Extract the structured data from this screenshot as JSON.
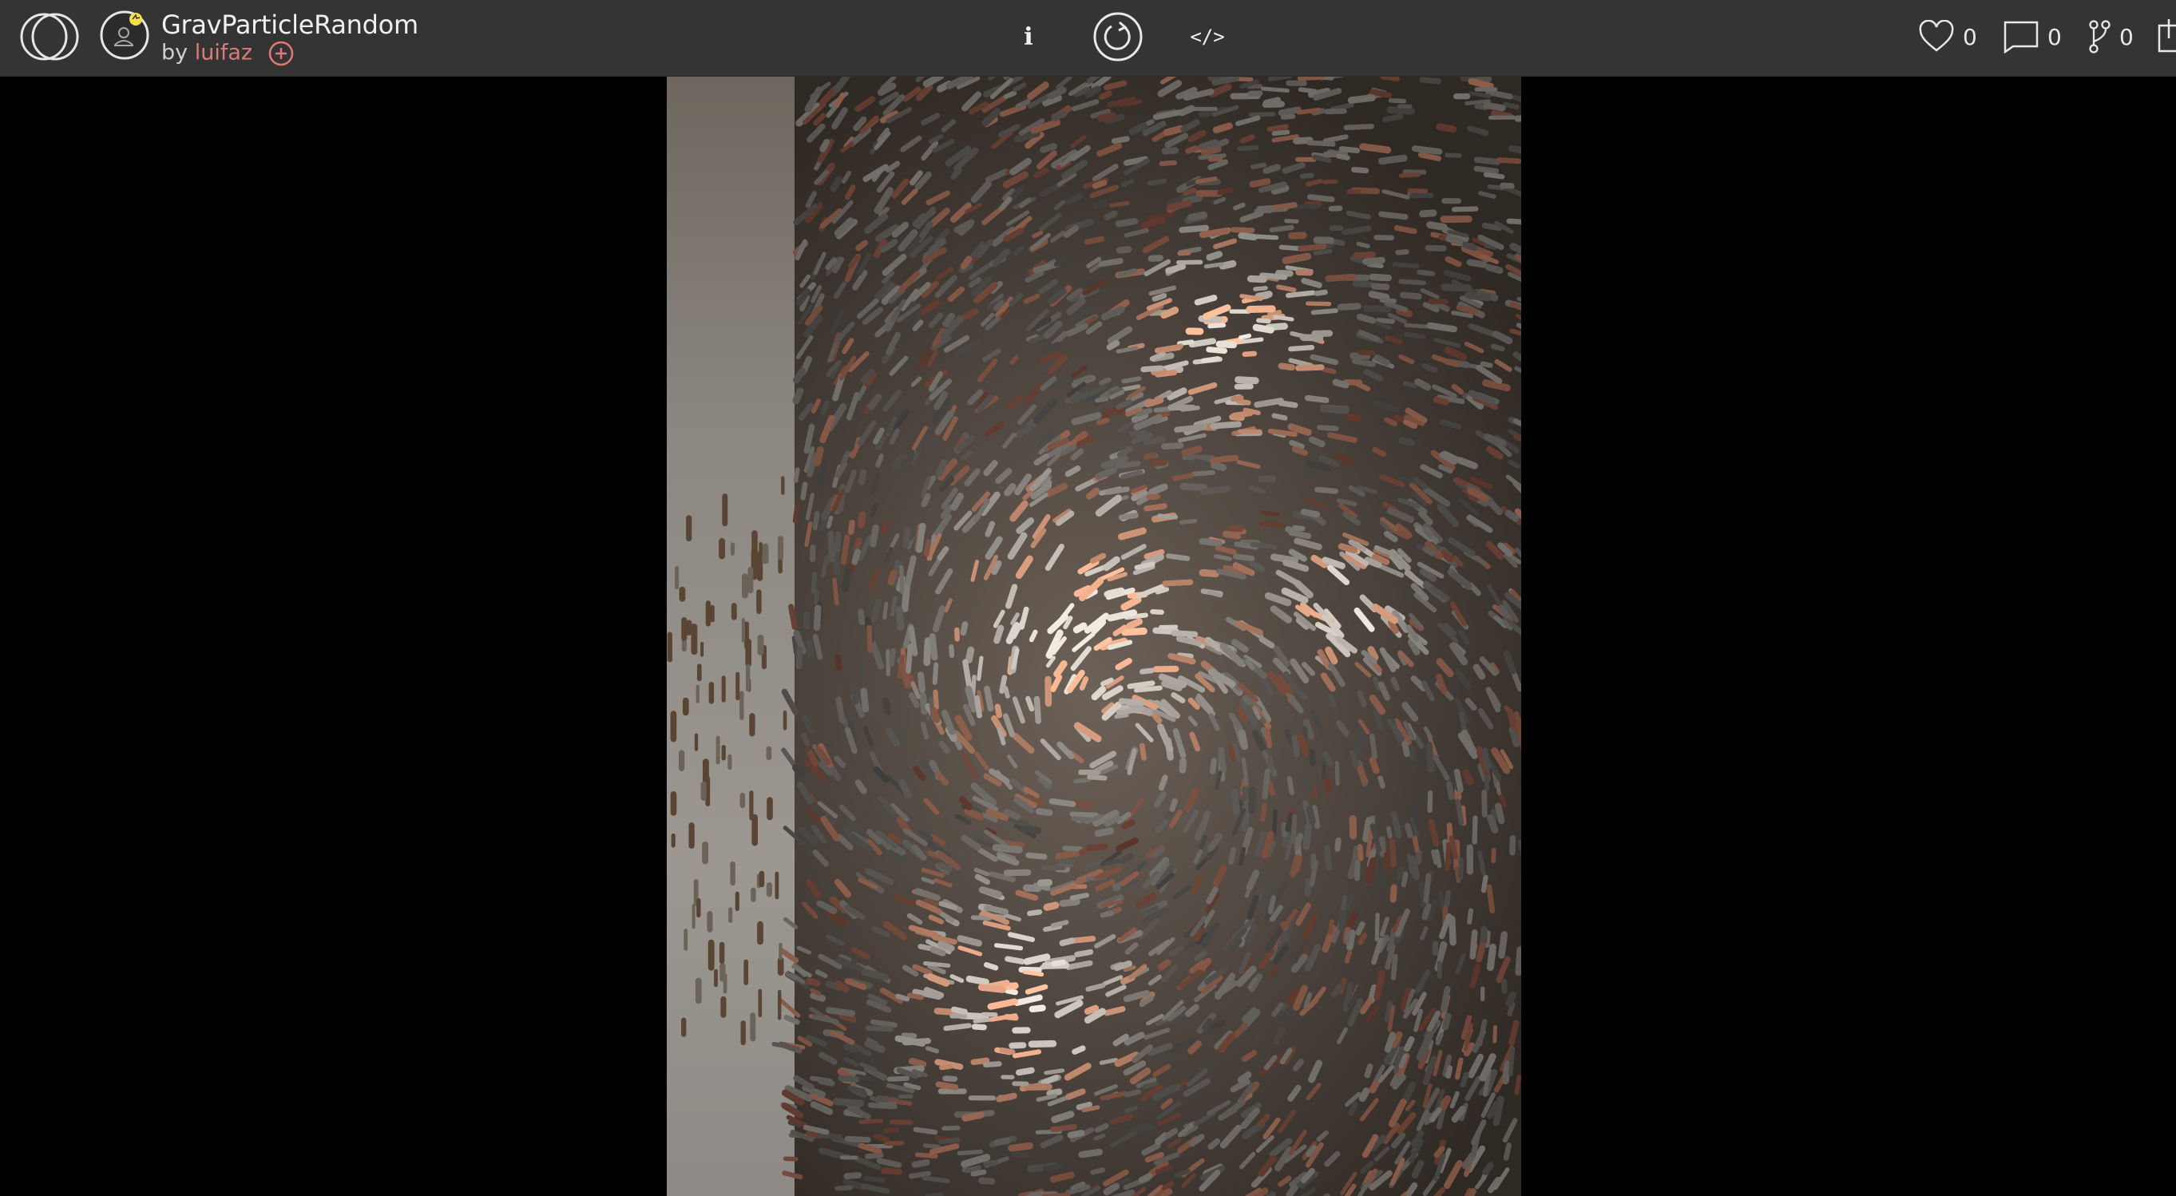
{
  "header": {
    "project_title": "GravParticleRandom",
    "by_prefix": "by",
    "author": "luifaz",
    "logo_icon": "openprocessing-logo-icon",
    "avatar_icon": "user-avatar-icon",
    "follow_icon": "plus-circle-icon"
  },
  "toolbar": {
    "info_label": "i",
    "info_icon": "info-icon",
    "reload_icon": "reload-icon",
    "code_label": "</>",
    "code_icon": "code-icon"
  },
  "stats": {
    "likes": "0",
    "comments": "0",
    "forks": "0",
    "likes_icon": "heart-icon",
    "comments_icon": "comment-icon",
    "forks_icon": "fork-icon",
    "share_icon": "share-icon"
  },
  "colors": {
    "topbar": "#343434",
    "accent_author": "#e07a78",
    "avatar_badge": "#f2e14a",
    "background": "#000000"
  }
}
